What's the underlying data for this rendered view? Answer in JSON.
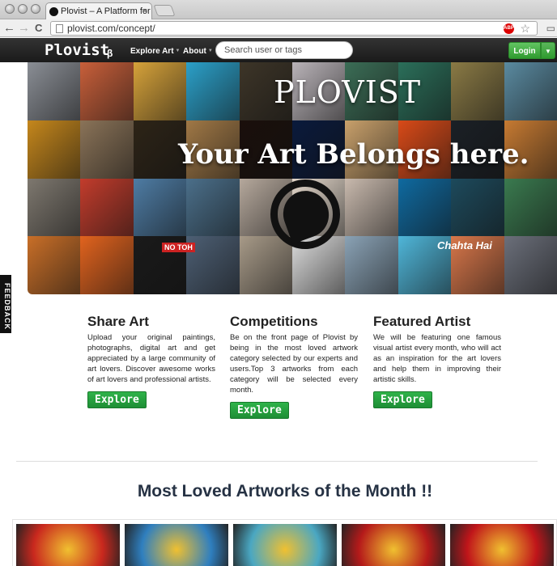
{
  "browser": {
    "tab_title": "Plovist – A Platform for Ar",
    "url": "plovist.com/concept/",
    "close_glyph": "×",
    "back_glyph": "←",
    "forward_glyph": "→",
    "reload_glyph": "C",
    "star_glyph": "☆"
  },
  "site": {
    "logo": "Plovist",
    "beta": "β",
    "nav": [
      {
        "label": "Explore Art"
      },
      {
        "label": "About"
      }
    ],
    "search_placeholder": "Search user or tags",
    "login_label": "Login",
    "feedback_label": "FEEDBACK"
  },
  "hero": {
    "title": "PLOVIST",
    "subtitle": "Your Art Belongs here.",
    "poster_text": "NO TOH",
    "chahta_text": "Chahta Hai",
    "tile_colors": [
      "#8a8e95",
      "#c85f3a",
      "#d6a23a",
      "#2ba0c9",
      "#3d3528",
      "#b9b3b8",
      "#3b6d56",
      "#2b6f5a",
      "#8a7a45",
      "#5a8aa0",
      "#c5871c",
      "#8a7358",
      "#2d2417",
      "#a07846",
      "#1a0f0b",
      "#0a1a3c",
      "#c8a06b",
      "#d84a18",
      "#1b2026",
      "#c67a32",
      "#7e786f",
      "#c23c2c",
      "#4e7ca4",
      "#4b6f8a",
      "#b5a89c",
      "#e4d8cb",
      "#c8b9ad",
      "#0f6aa0",
      "#1d4a5c",
      "#3a7a4f",
      "#c96f28",
      "#e1631e",
      "#1a1a1a",
      "#4d5f74",
      "#a79a88",
      "#dcdcdc",
      "#8aa2b5",
      "#4fb6d9",
      "#d9774a",
      "#6b6f7a"
    ]
  },
  "features": [
    {
      "title": "Share Art",
      "body": "Upload your original paintings, photographs, digital art and get appreciated by a large community of art lovers. Discover awesome works of art lovers and professional artists.",
      "button": "Explore"
    },
    {
      "title": "Competitions",
      "body": "Be on the front page of Plovist by being in the most loved artwork category selected by our experts and users.Top 3 artworks from each category will be selected every month.",
      "button": "Explore"
    },
    {
      "title": "Featured Artist",
      "body": "We will be featuring one famous visual artist every month, who will act as an inspiration for the art lovers and help them in improving their artistic skills.",
      "button": "Explore"
    }
  ],
  "section": {
    "title": "Most Loved Artworks of the Month !!"
  },
  "gallery": {
    "thumb_colors": [
      "#c9281e",
      "#2f7fbf",
      "#4aa7c2",
      "#b51a1a",
      "#c0151a"
    ]
  }
}
